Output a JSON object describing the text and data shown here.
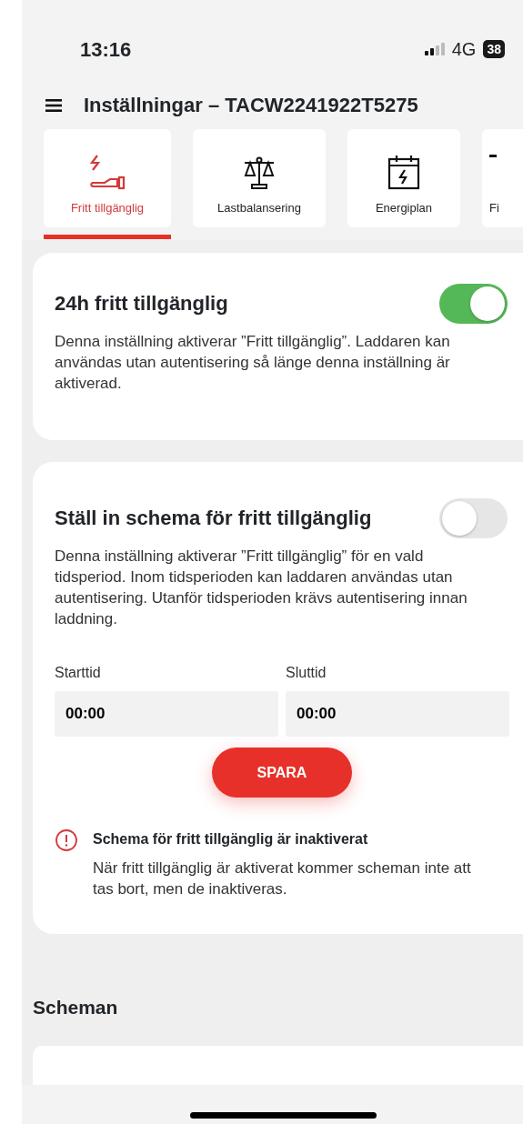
{
  "status_bar": {
    "time": "13:16",
    "network": "4G",
    "battery": "38"
  },
  "header": {
    "title": "Inställningar – TACW2241922T5275"
  },
  "tabs": [
    {
      "label": "Fritt tillgänglig",
      "kind": "hand-bolt",
      "selected": true
    },
    {
      "label": "Lastbalansering",
      "kind": "scale",
      "selected": false
    },
    {
      "label": "Energiplan",
      "kind": "calendar-bolt",
      "selected": false
    },
    {
      "label": "Fi",
      "kind": "partial",
      "selected": false
    }
  ],
  "free_access": {
    "title": "24h fritt tillgänglig",
    "on": true,
    "description": "Denna inställning aktiverar ”Fritt tillgänglig”. Laddaren kan användas utan autentisering så länge denna inställning är aktiverad."
  },
  "schedule": {
    "title": "Ställ in schema för fritt tillgänglig",
    "on": false,
    "description": "Denna inställning aktiverar ”Fritt tillgänglig” för en vald tidsperiod. Inom tidsperioden kan laddaren användas utan autentisering. Utanför tidsperioden krävs autentisering innan laddning.",
    "start_label": "Starttid",
    "start_value": "00:00",
    "end_label": "Sluttid",
    "end_value": "00:00",
    "save_button": "SPARA",
    "warning": {
      "title": "Schema för fritt tillgänglig är inaktiverat",
      "text": "När fritt tillgänglig är aktiverat kommer scheman inte att tas bort, men de inaktiveras."
    }
  },
  "schedules_heading": "Scheman"
}
